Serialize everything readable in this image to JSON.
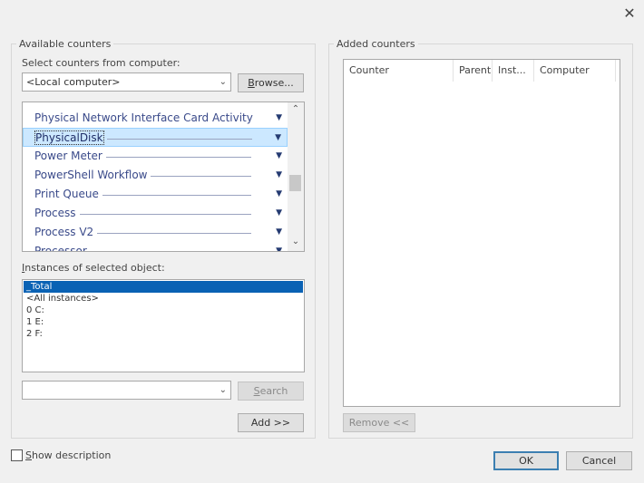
{
  "dialog": {
    "close_glyph": "✕"
  },
  "available": {
    "legend": "Available counters",
    "computer_label": "Select counters from computer:",
    "computer_value": "<Local computer>",
    "browse_label": "Browse...",
    "objects": [
      {
        "label": "Physical Network Interface Card Activity",
        "selected": false
      },
      {
        "label": "PhysicalDisk",
        "selected": true
      },
      {
        "label": "Power Meter",
        "selected": false
      },
      {
        "label": "PowerShell Workflow",
        "selected": false
      },
      {
        "label": "Print Queue",
        "selected": false
      },
      {
        "label": "Process",
        "selected": false
      },
      {
        "label": "Process V2",
        "selected": false
      },
      {
        "label": "Processor",
        "selected": false
      }
    ],
    "instances_label": "Instances of selected object:",
    "instances": [
      {
        "label": "_Total",
        "selected": true
      },
      {
        "label": "<All instances>",
        "selected": false
      },
      {
        "label": "0 C:",
        "selected": false
      },
      {
        "label": "1 E:",
        "selected": false
      },
      {
        "label": "2 F:",
        "selected": false
      }
    ],
    "search_value": "",
    "search_label": "Search",
    "add_label": "Add >>"
  },
  "added": {
    "legend": "Added counters",
    "columns": [
      "Counter",
      "Parent",
      "Inst...",
      "Computer"
    ],
    "remove_label": "Remove <<"
  },
  "footer": {
    "show_description_label": "Show description",
    "show_description_checked": false,
    "ok_label": "OK",
    "cancel_label": "Cancel"
  }
}
